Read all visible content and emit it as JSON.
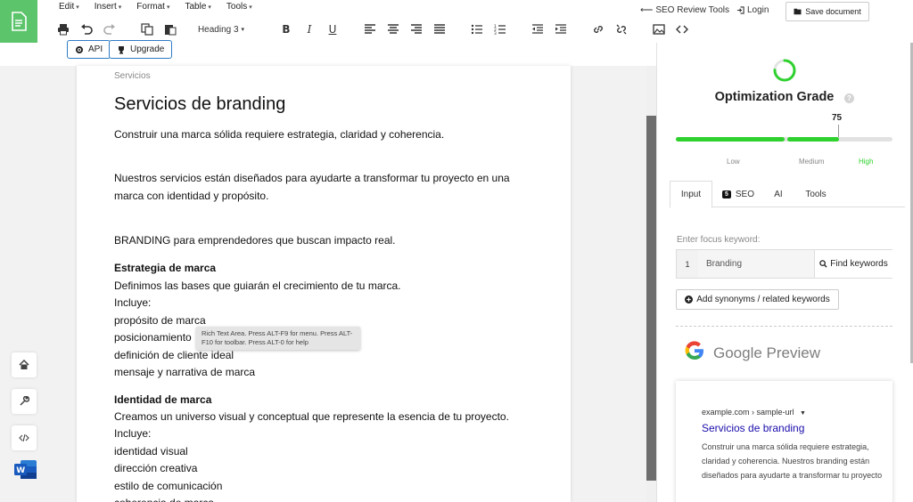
{
  "menu": [
    "Edit",
    "Insert",
    "Format",
    "Table",
    "Tools"
  ],
  "toolbar": {
    "heading_select": "Heading 3"
  },
  "subtoolbar": {
    "api_label": "API",
    "upgrade_label": "Upgrade"
  },
  "header": {
    "seo_review_link": "SEO Review Tools",
    "login_link": "Login",
    "save_button": "Save document"
  },
  "document": {
    "breadcrumb": "Servicios",
    "title": "Servicios de branding",
    "lines": [
      {
        "text": "Construir una marca sólida requiere estrategia, claridad y coherencia.",
        "bold": false
      },
      {
        "text": "Nuestros servicios están diseñados para ayudarte a transformar tu proyecto en una",
        "bold": false
      },
      {
        "text": "marca con identidad y propósito.",
        "bold": false
      },
      {
        "text": "BRANDING para emprendedores que buscan impacto real.",
        "bold": false
      },
      {
        "text": "Estrategia de marca",
        "bold": true
      },
      {
        "text": "Definimos las bases que guiarán el crecimiento de tu marca.",
        "bold": false
      },
      {
        "text": "Incluye:",
        "bold": false
      },
      {
        "text": "propósito de marca",
        "bold": false
      },
      {
        "text": "posicionamiento",
        "bold": false
      },
      {
        "text": "definición de cliente ideal",
        "bold": false
      },
      {
        "text": "mensaje y narrativa de marca",
        "bold": false
      },
      {
        "text": "Identidad de marca",
        "bold": true
      },
      {
        "text": "Creamos un universo visual y conceptual que represente la esencia de tu proyecto.",
        "bold": false
      },
      {
        "text": "Incluye:",
        "bold": false
      },
      {
        "text": "identidad visual",
        "bold": false
      },
      {
        "text": "dirección creativa",
        "bold": false
      },
      {
        "text": "estilo de comunicación",
        "bold": false
      },
      {
        "text": "coherencia de marca",
        "bold": false
      }
    ],
    "tooltip": "Rich Text Area. Press ALT-F9 for menu. Press ALT-F10 for toolbar. Press ALT-0 for help"
  },
  "panel": {
    "grade_title": "Optimization Grade",
    "help": "?",
    "score": "75",
    "score_value": 75,
    "grade_levels": [
      "Low",
      "Medium",
      "High"
    ],
    "tabs": [
      {
        "label": "Input",
        "active": true
      },
      {
        "label": "SEO",
        "badge": "5",
        "active": false
      },
      {
        "label": "AI",
        "active": false
      },
      {
        "label": "Tools",
        "active": false
      }
    ],
    "focus_label": "Enter focus keyword:",
    "keyword_number": "1",
    "keyword_value": "Branding",
    "find_keywords_button": "Find keywords",
    "add_synonyms_button": "Add synonyms / related keywords",
    "google_preview_title": "Google Preview",
    "preview": {
      "url": "example.com › sample-url",
      "title": "Servicios de branding",
      "description": "Construir una marca sólida requiere estrategia, claridad y coherencia. Nuestros branding están diseñados para ayudarte a transformar tu proyecto"
    }
  },
  "colors": {
    "brand_green": "#5cc46b",
    "grade_green": "#2ed12e",
    "link_blue": "#1a0dab",
    "button_border": "#2e7bc4"
  }
}
